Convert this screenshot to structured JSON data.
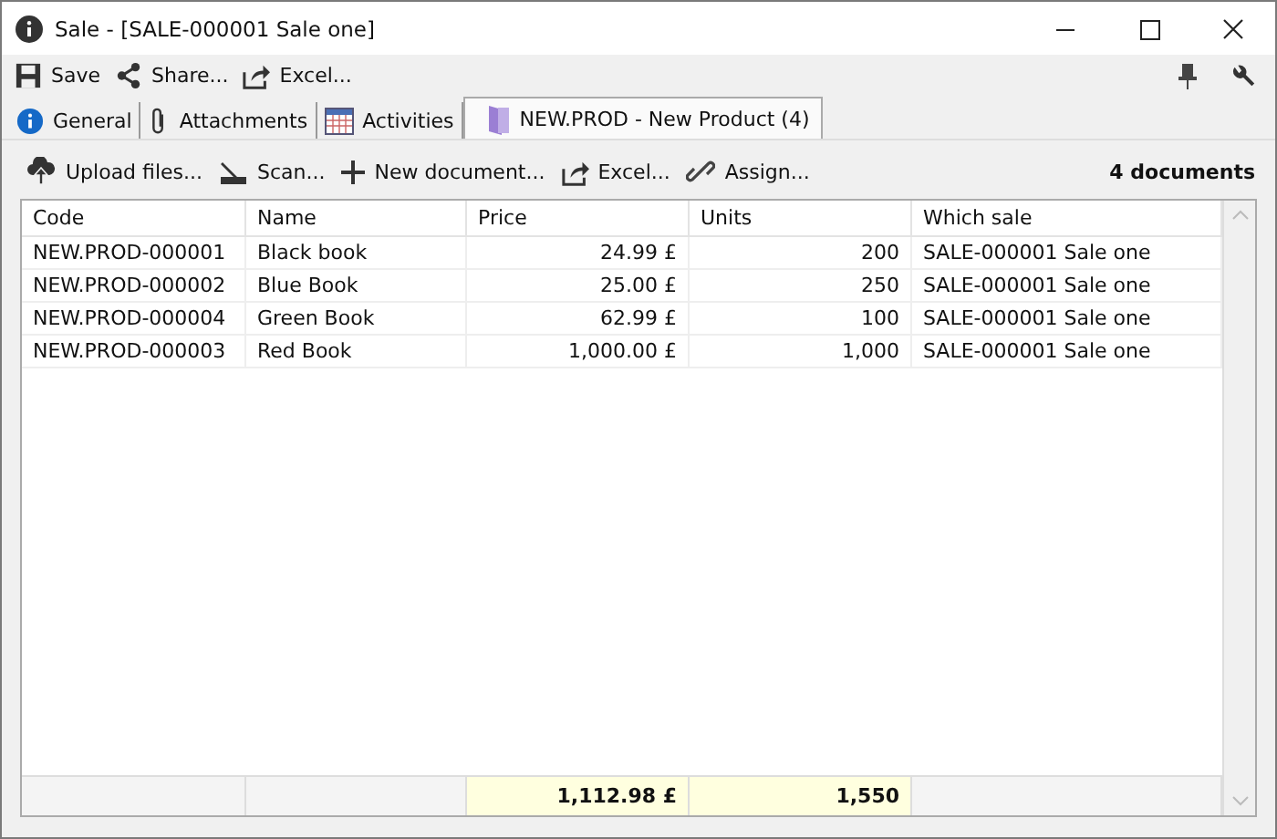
{
  "window": {
    "title": "Sale - [SALE-000001 Sale one]"
  },
  "toolbar": [
    "Save",
    "Share...",
    "Excel..."
  ],
  "tabs": [
    {
      "label": "General",
      "selected": false
    },
    {
      "label": "Attachments",
      "selected": false
    },
    {
      "label": "Activities",
      "selected": false
    },
    {
      "label": "NEW.PROD - New Product (4)",
      "selected": true
    }
  ],
  "doc_toolbar": [
    "Upload files...",
    "Scan...",
    "New document...",
    "Excel...",
    "Assign..."
  ],
  "document_count": "4 documents",
  "table": {
    "columns": [
      {
        "label": "Code",
        "kind": "text"
      },
      {
        "label": "Name",
        "kind": "text"
      },
      {
        "label": "Price",
        "kind": "number",
        "total": "1,112.98 £"
      },
      {
        "label": "Units",
        "kind": "number",
        "total": "1,550"
      },
      {
        "label": "Which sale",
        "kind": "text"
      }
    ],
    "rows": [
      [
        "NEW.PROD-000001",
        "Black book",
        "24.99 £",
        "200",
        "SALE-000001 Sale one"
      ],
      [
        "NEW.PROD-000002",
        "Blue Book",
        "25.00 £",
        "250",
        "SALE-000001 Sale one"
      ],
      [
        "NEW.PROD-000004",
        "Green Book",
        "62.99 £",
        "100",
        "SALE-000001 Sale one"
      ],
      [
        "NEW.PROD-000003",
        "Red Book",
        "1,000.00 £",
        "1,000",
        "SALE-000001 Sale one"
      ]
    ]
  }
}
